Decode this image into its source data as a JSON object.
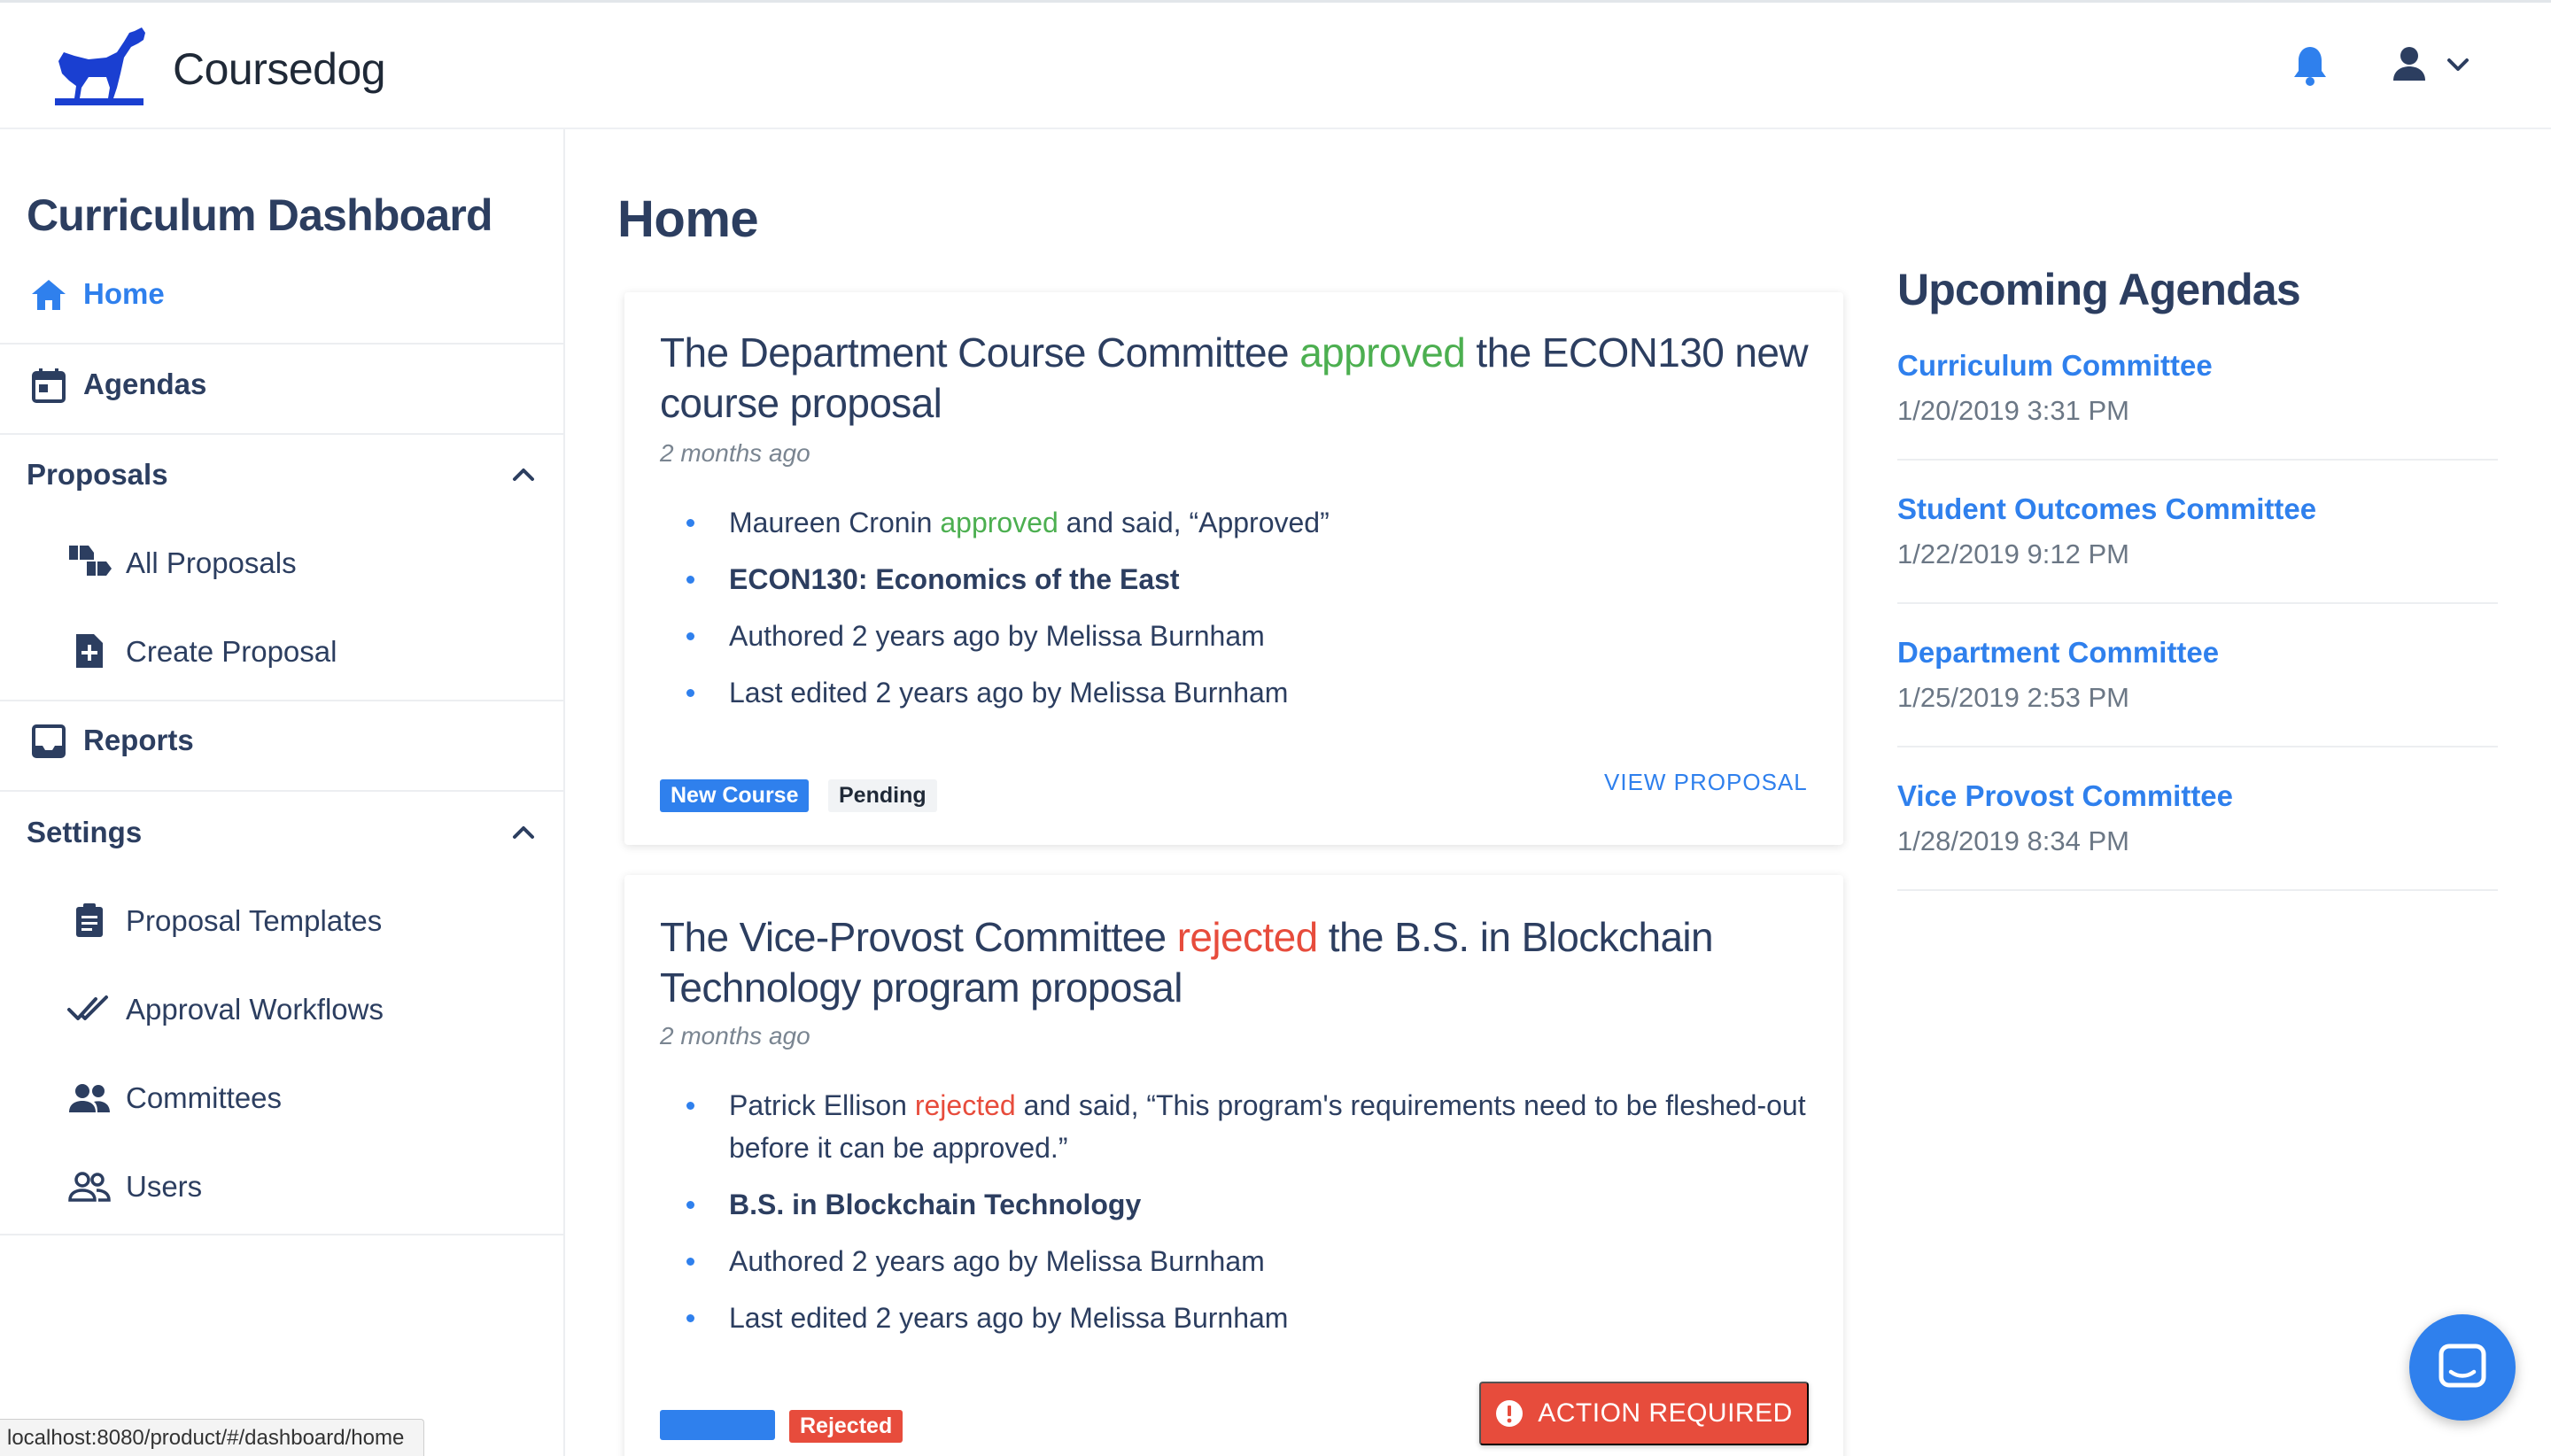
{
  "header": {
    "brand": "Coursedog",
    "icons": [
      "dog-logo-icon",
      "bell-icon",
      "user-icon",
      "chevron-down-icon"
    ],
    "colors": {
      "accent": "#2f80ed",
      "logo": "#1a3fd1"
    }
  },
  "sidebar": {
    "title": "Curriculum Dashboard",
    "home": "Home",
    "agendas": "Agendas",
    "proposals": {
      "label": "Proposals",
      "items": [
        {
          "label": "All Proposals",
          "icon": "thumbs-icon"
        },
        {
          "label": "Create Proposal",
          "icon": "file-plus-icon"
        }
      ]
    },
    "reports": "Reports",
    "settings": {
      "label": "Settings",
      "items": [
        {
          "label": "Proposal Templates",
          "icon": "clipboard-icon"
        },
        {
          "label": "Approval Workflows",
          "icon": "double-check-icon"
        },
        {
          "label": "Committees",
          "icon": "people-icon"
        },
        {
          "label": "Users",
          "icon": "people-outline-icon"
        }
      ]
    }
  },
  "main": {
    "title": "Home",
    "cards": [
      {
        "title_before": "The Department Course Committee ",
        "title_action": "approved",
        "title_after": " the ECON130 new course proposal",
        "ago": "2 months ago",
        "bullet1_before": "Maureen Cronin ",
        "bullet1_action": "approved",
        "bullet1_after": " and said, “Approved”",
        "bullet2": "ECON130: Economics of the East",
        "bullet3": "Authored 2 years ago by Melissa Burnham",
        "bullet4": "Last edited 2 years ago by Melissa Burnham",
        "tag1": "New Course",
        "tag2": "Pending",
        "link": "VIEW PROPOSAL"
      },
      {
        "title_before": "The Vice-Provost Committee ",
        "title_action": "rejected",
        "title_after": " the B.S. in Blockchain Technology program proposal",
        "ago": "2 months ago",
        "bullet1_before": "Patrick Ellison ",
        "bullet1_action": "rejected",
        "bullet1_after": " and said, “This program's requirements need to be fleshed-out before it can be approved.”",
        "bullet2": "B.S. in Blockchain Technology",
        "bullet3": "Authored 2 years ago by Melissa Burnham",
        "bullet4": "Last edited 2 years ago by Melissa Burnham",
        "tag2": "Rejected",
        "action": "ACTION REQUIRED"
      }
    ]
  },
  "agendas": {
    "title": "Upcoming Agendas",
    "items": [
      {
        "name": "Curriculum Committee",
        "date": "1/20/2019 3:31 PM"
      },
      {
        "name": "Student Outcomes Committee",
        "date": "1/22/2019 9:12 PM"
      },
      {
        "name": "Department Committee",
        "date": "1/25/2019 2:53 PM"
      },
      {
        "name": "Vice Provost Committee",
        "date": "1/28/2019 8:34 PM"
      }
    ]
  },
  "statusbar": {
    "url": "localhost:8080/product/#/dashboard/home"
  }
}
